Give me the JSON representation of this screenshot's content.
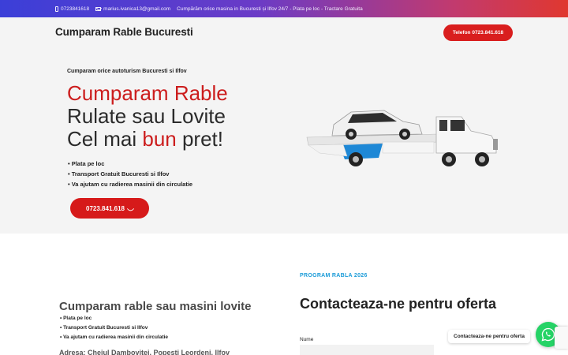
{
  "topbar": {
    "phone": "0723841618",
    "email": "marius.ivanica13@gmail.com",
    "tagline": "Cumpărăm orice masina in Bucuresti și Ilfov 24/7 - Plata pe loc - Tractare Gratuita"
  },
  "header": {
    "logo": "Cumparam Rable Bucuresti",
    "phone_button": "Telefon 0723.841.618"
  },
  "hero": {
    "subtitle": "Cumparam orice autoturism Bucuresti si Ilfov",
    "title_line1": "Cumparam Rable",
    "title_line2": "Rulate sau Lovite",
    "title_line3_pre": "Cel mai ",
    "title_line3_red": "bun",
    "title_line3_post": " pret!",
    "bullets": [
      "• Plata pe loc",
      "• Transport Gratuit Bucuresti si Ilfov",
      "• Va ajutam cu radierea masinii din circulatie"
    ],
    "cta": "0723.841.618"
  },
  "section2": {
    "title": "Cumparam rable sau masini lovite",
    "bullets": [
      "• Plata pe loc",
      "• Transport Gratuit Bucuresti si Ilfov",
      "• Va ajutam cu radierea masinii din circulatie"
    ],
    "address": "Adresa: Cheiul Dambovitei, Popesti Leordeni, Ilfov",
    "program": "PROGRAM RABLA 2026",
    "contact_title": "Contacteaza-ne pentru oferta",
    "name_label": "Nume"
  },
  "whatsapp": {
    "tooltip": "Contacteaza-ne pentru oferta"
  },
  "colors": {
    "accent_red": "#d61a1a",
    "program_blue": "#1a9bd8",
    "whatsapp_green": "#25d366"
  }
}
